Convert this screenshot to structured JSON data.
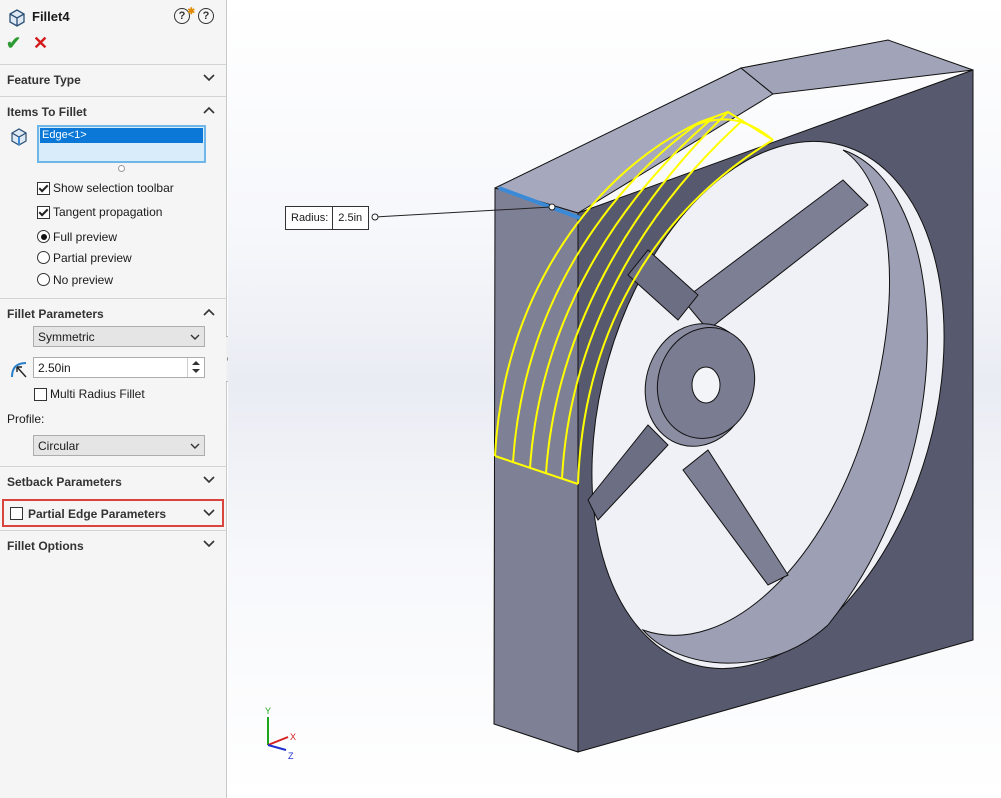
{
  "panel": {
    "title": "Fillet4",
    "help_glyph": "?",
    "sections": {
      "feature_type": "Feature Type",
      "items_to_fillet": "Items To Fillet",
      "fillet_parameters": "Fillet Parameters",
      "setback_parameters": "Setback Parameters",
      "partial_edge_parameters": "Partial Edge Parameters",
      "fillet_options": "Fillet Options"
    },
    "selection": {
      "item": "Edge<1>"
    },
    "options": {
      "show_selection_toolbar": "Show selection toolbar",
      "tangent_propagation": "Tangent propagation",
      "full_preview": "Full preview",
      "partial_preview": "Partial preview",
      "no_preview": "No preview"
    },
    "fillet_type": "Symmetric",
    "radius_value": "2.50in",
    "multi_radius": "Multi Radius Fillet",
    "profile_label": "Profile:",
    "profile_value": "Circular"
  },
  "viewport": {
    "callout_label": "Radius:",
    "callout_value": "2.5in",
    "triad": {
      "x": "X",
      "y": "Y",
      "z": "Z"
    }
  },
  "colors": {
    "accent_selection": "#0b78d7",
    "fillet_preview": "#ffff00",
    "highlight_box": "#d9453d",
    "ok": "#2e9a33",
    "cancel": "#d41a1a"
  }
}
